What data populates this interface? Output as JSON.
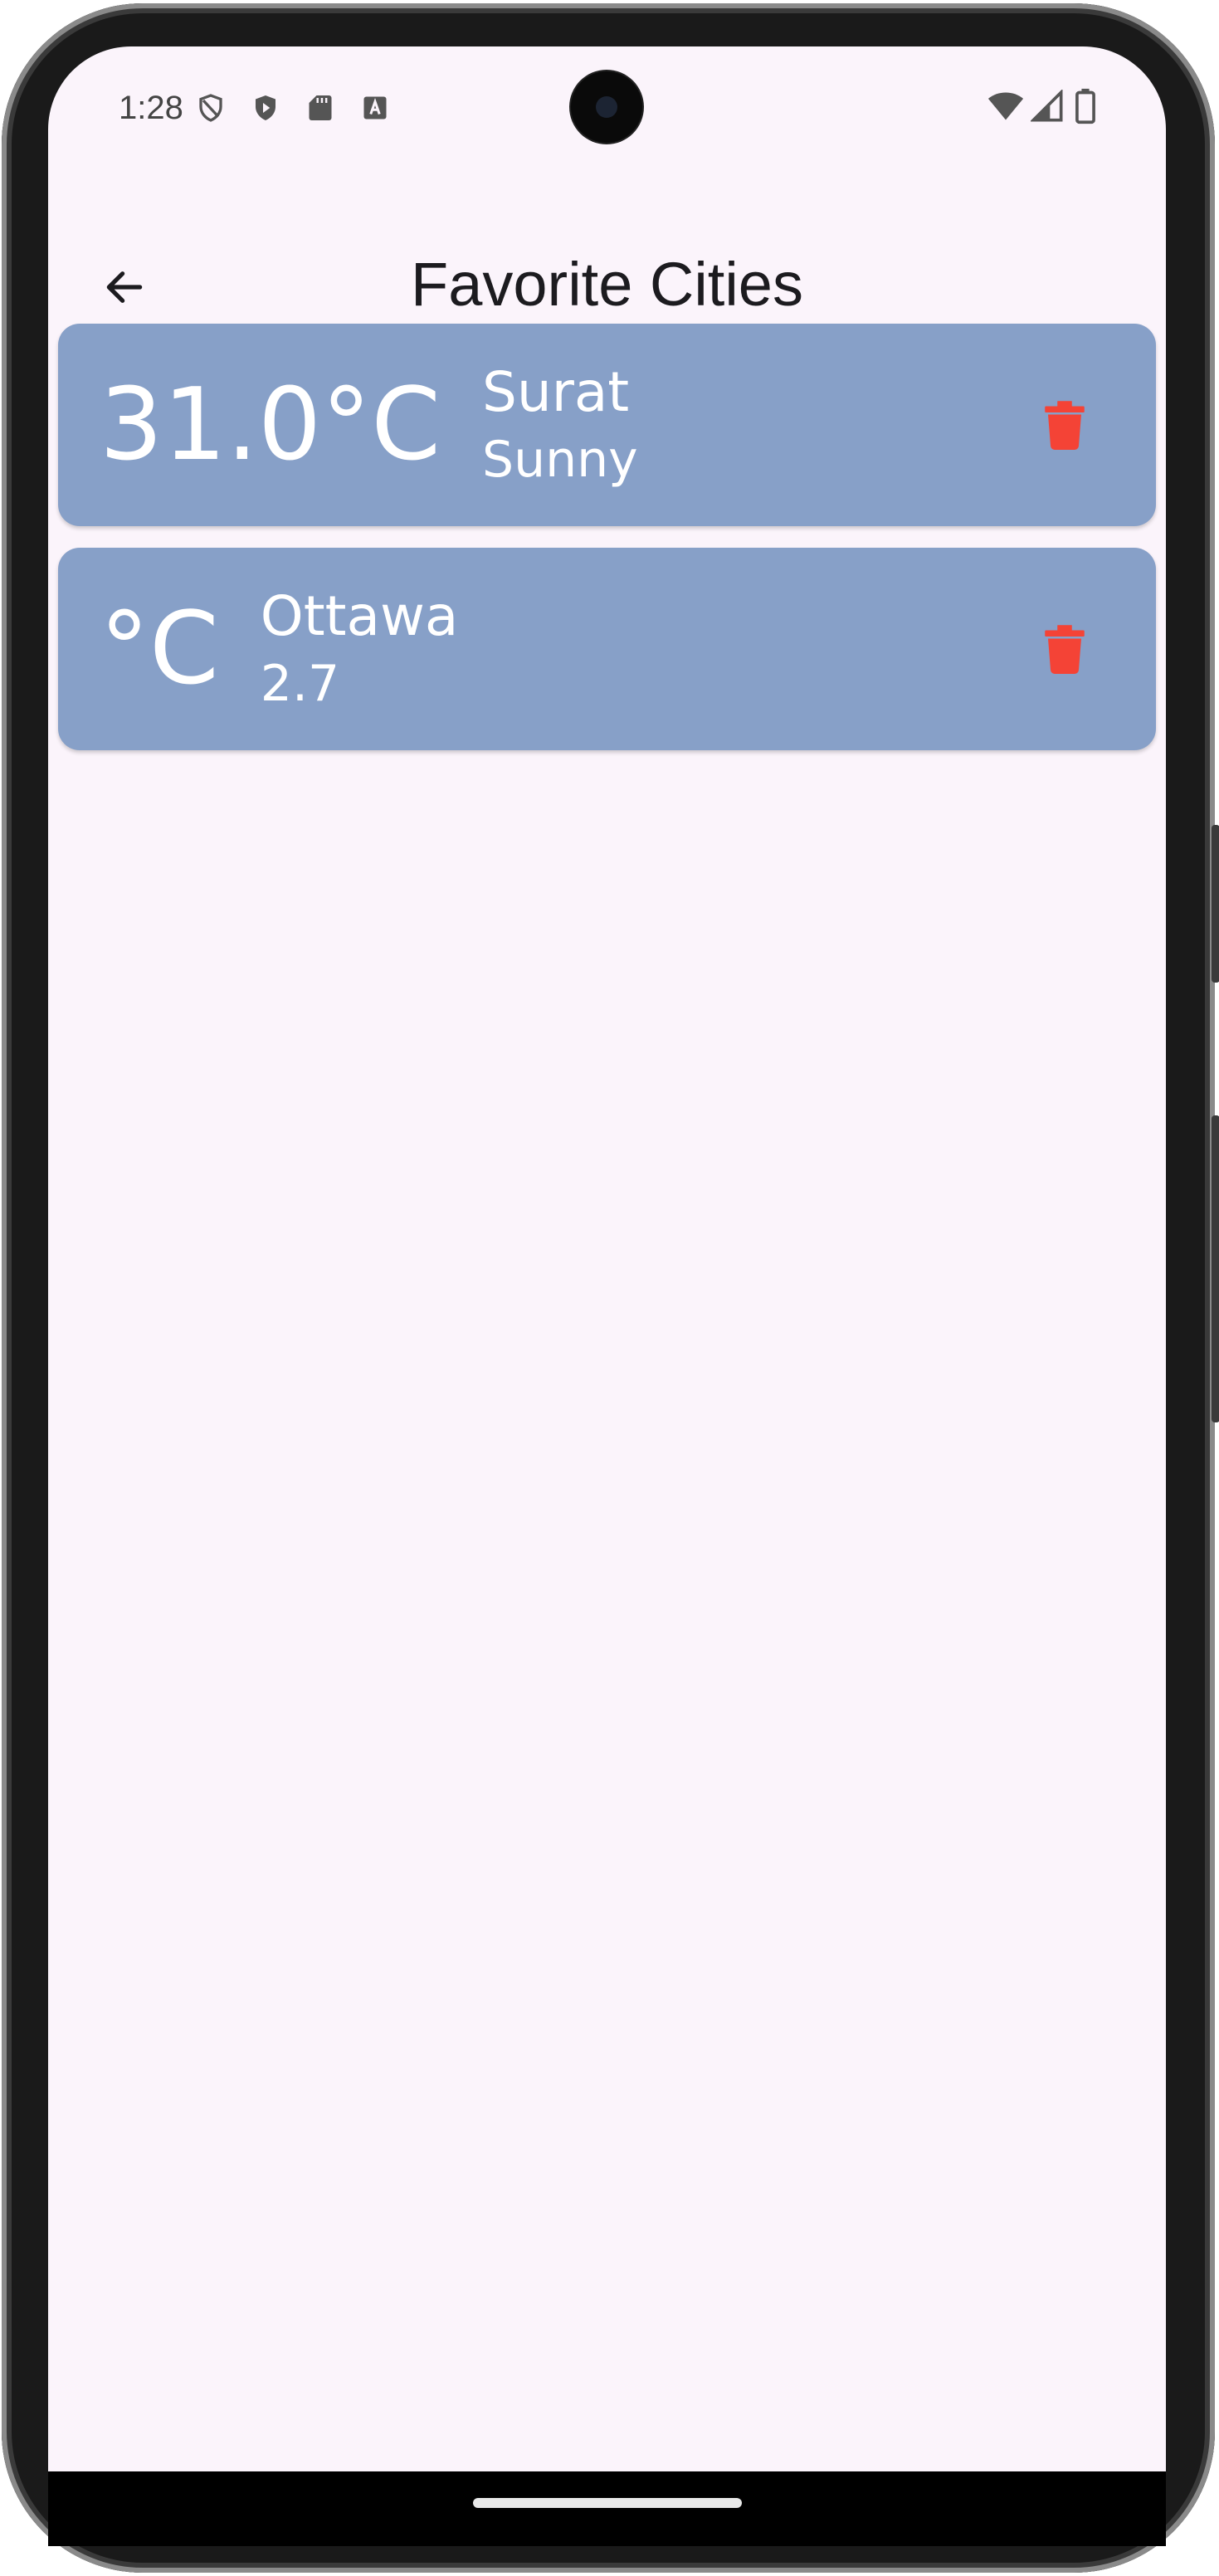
{
  "status_bar": {
    "time": "1:28",
    "left_icons": [
      "shield-outline-icon",
      "play-shield-icon",
      "sd-card-icon",
      "keyboard-a-icon"
    ],
    "right_icons": [
      "wifi-icon",
      "signal-icon",
      "battery-icon"
    ]
  },
  "app_bar": {
    "title": "Favorite Cities",
    "back_icon": "arrow-back-icon"
  },
  "colors": {
    "background": "#fbf4fb",
    "card": "#87a0c8",
    "card_text": "#ffffff",
    "delete": "#f44336",
    "title": "#1c1b1f"
  },
  "cities": [
    {
      "temperature": "31.0°C",
      "name": "Surat",
      "subtitle": "Sunny",
      "delete_icon": "trash-icon"
    },
    {
      "temperature": "°C",
      "name": "Ottawa",
      "subtitle": "2.7",
      "delete_icon": "trash-icon"
    }
  ]
}
